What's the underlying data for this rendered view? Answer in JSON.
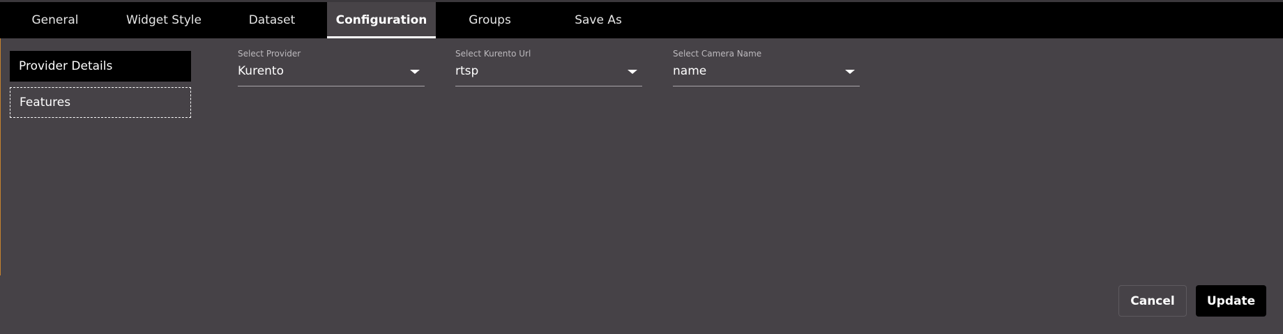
{
  "tabs": [
    {
      "label": "General"
    },
    {
      "label": "Widget Style"
    },
    {
      "label": "Dataset"
    },
    {
      "label": "Configuration",
      "active": true
    },
    {
      "label": "Groups"
    },
    {
      "label": "Save As"
    }
  ],
  "sidebar": {
    "items": [
      {
        "label": "Provider Details",
        "selected": true
      },
      {
        "label": "Features"
      }
    ]
  },
  "fields": {
    "provider": {
      "label": "Select Provider",
      "value": "Kurento",
      "icon": "chevron-down-icon"
    },
    "kurento_url": {
      "label": "Select Kurento Url",
      "value": "rtsp",
      "icon": "chevron-down-icon"
    },
    "camera_name": {
      "label": "Select Camera Name",
      "value": "name",
      "icon": "chevron-down-icon"
    }
  },
  "actions": {
    "cancel_label": "Cancel",
    "update_label": "Update"
  },
  "colors": {
    "background": "#464247",
    "tabbar": "#000000",
    "active_tab": "#474347",
    "primary_button": "#000000",
    "accent_edge": "#c7832f"
  }
}
